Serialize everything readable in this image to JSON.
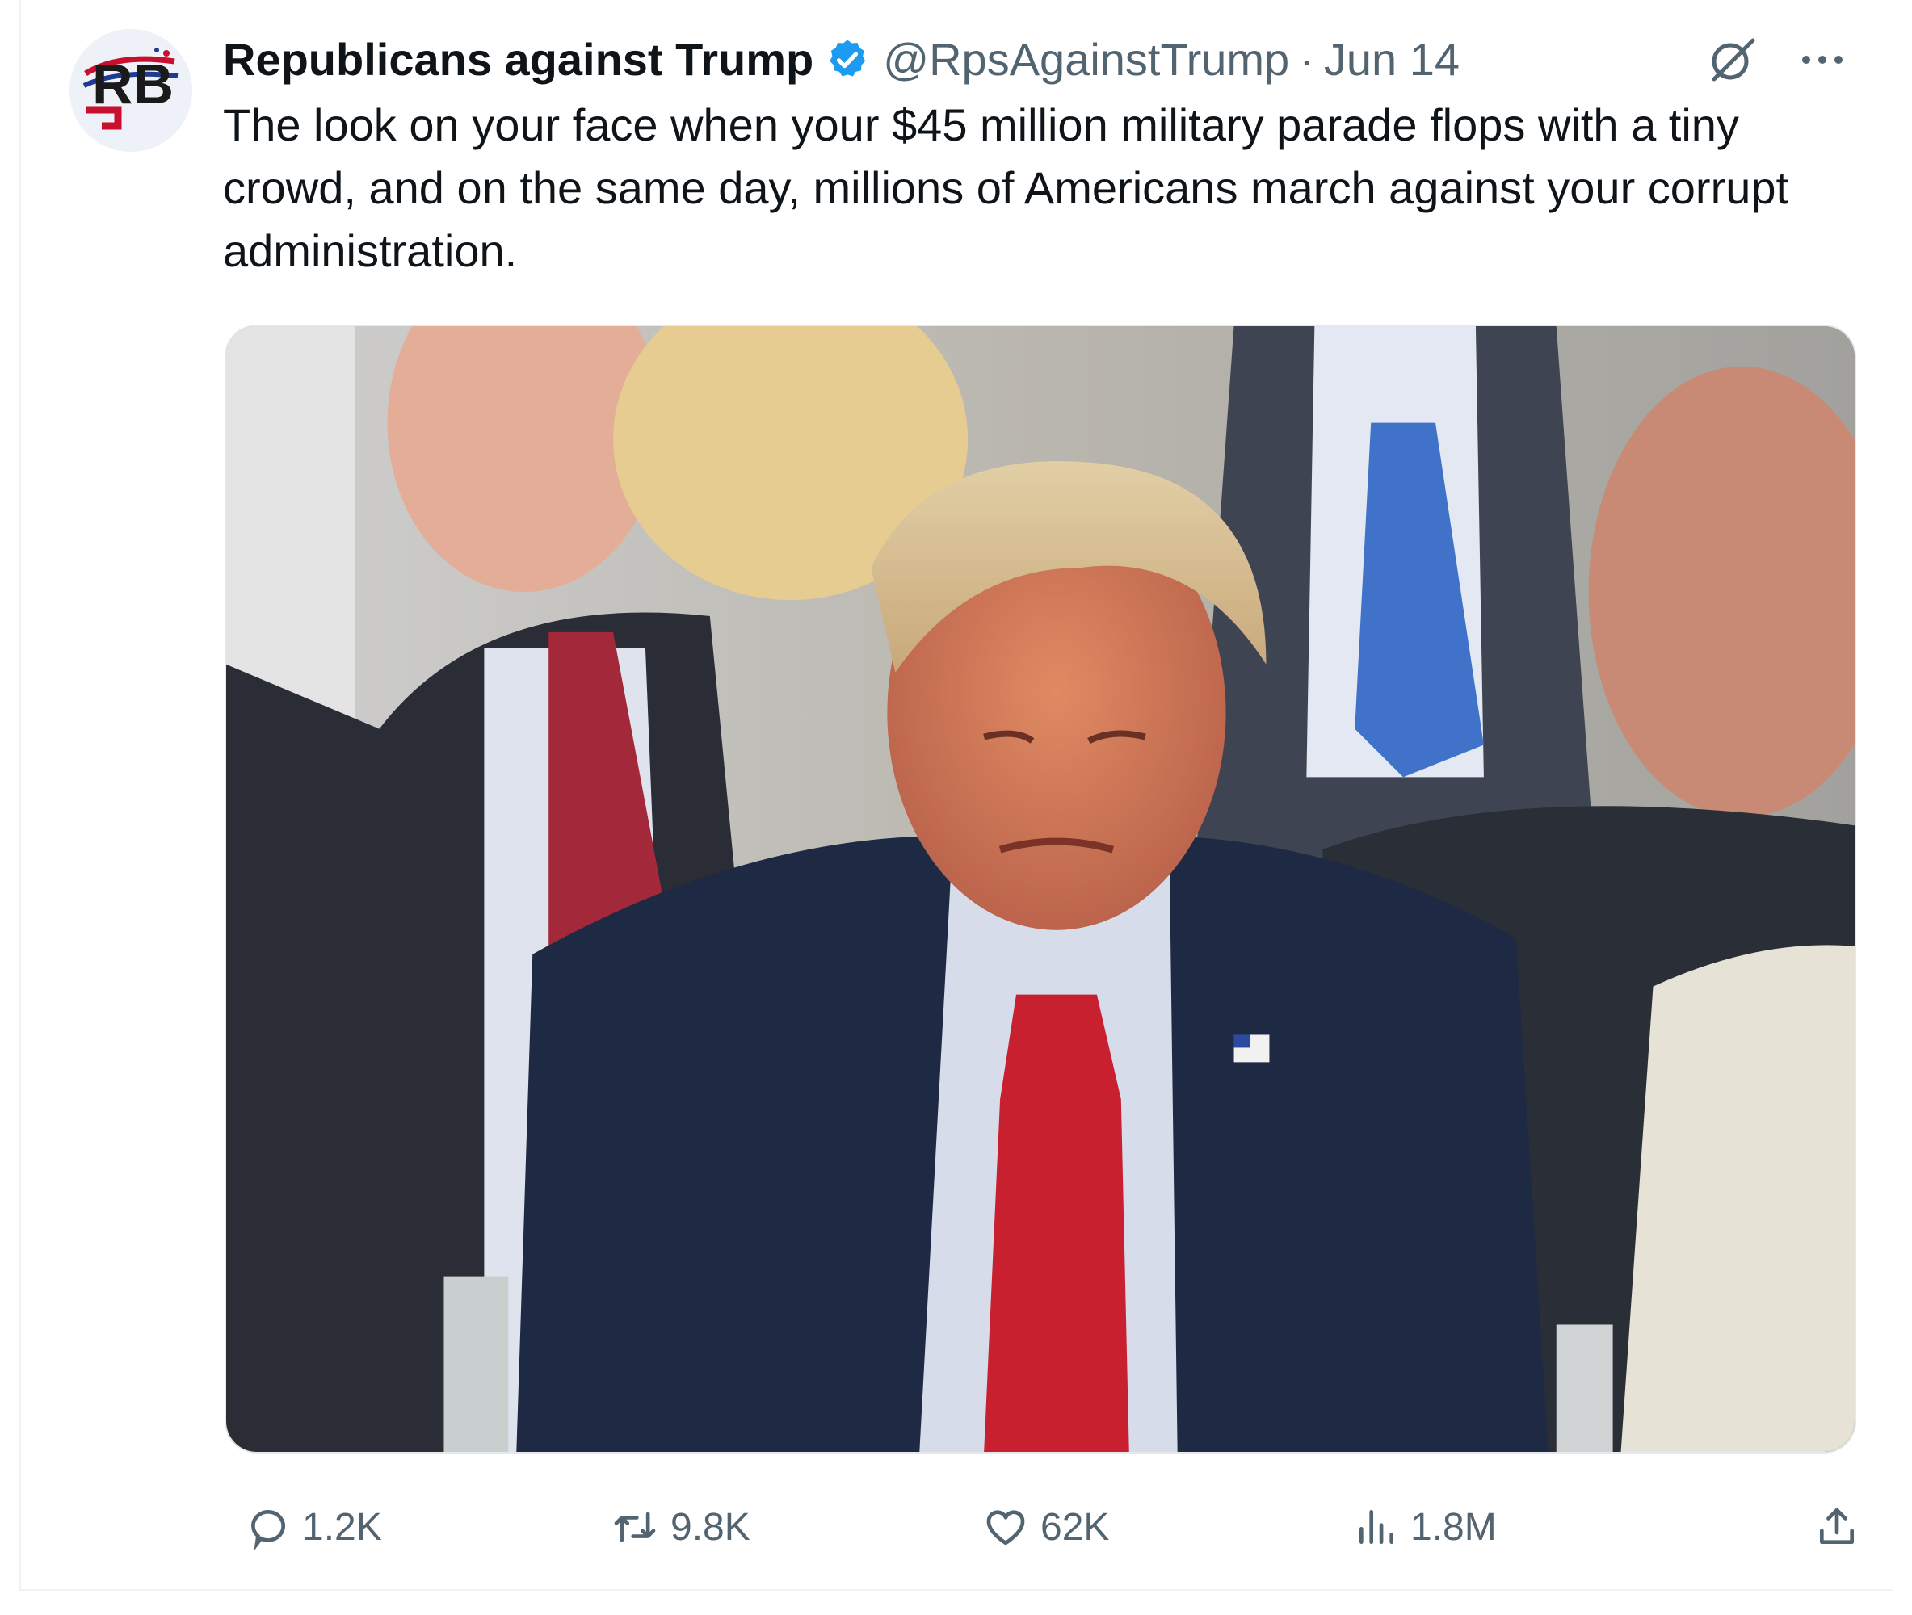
{
  "tweet": {
    "avatar": {
      "icon": "rb-logo-avatar",
      "logo_text": "RB"
    },
    "author": {
      "display_name": "Republicans against Trump",
      "verified_icon": "verified-badge-icon",
      "handle": "@RpsAgainstTrump",
      "separator": "·",
      "date": "Jun 14"
    },
    "header_icons": [
      "grok-icon",
      "more-icon"
    ],
    "text": "The look on your face when your $45 million military parade flops with a tiny crowd, and on the same day, millions of Americans march against your corrupt administration.",
    "media": {
      "type": "photo"
    },
    "metrics": {
      "replies": "1.2K",
      "retweets": "9.8K",
      "likes": "62K",
      "views": "1.8M"
    },
    "action_icons": [
      "reply-icon",
      "retweet-icon",
      "like-icon",
      "views-icon",
      "share-icon"
    ]
  },
  "colors": {
    "text_primary": "#0f1419",
    "text_secondary": "#536471",
    "verified_blue": "#1d9bf0",
    "border": "#eff3f4"
  }
}
